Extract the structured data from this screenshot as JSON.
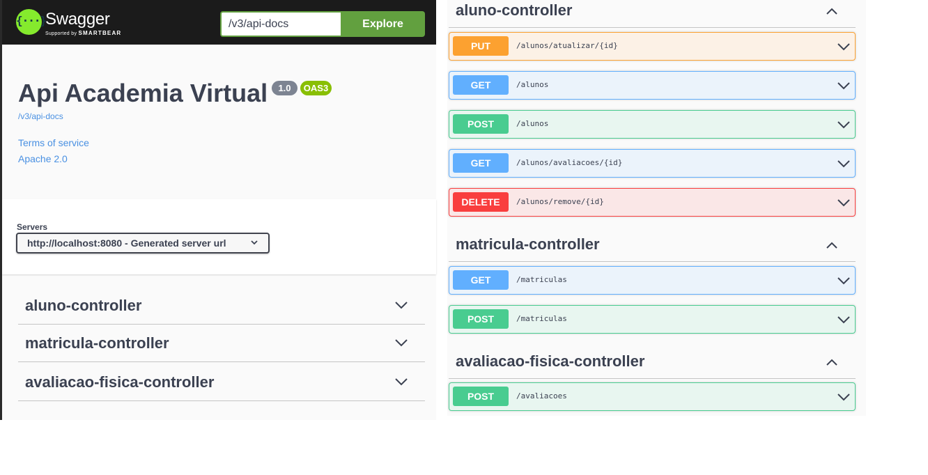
{
  "header": {
    "brand": "Swagger",
    "brand_sub_prefix": "Supported by",
    "brand_sub_company": "SMARTBEAR",
    "logo_glyph": "{···}",
    "url_value": "/v3/api-docs",
    "explore_label": "Explore"
  },
  "info": {
    "title": "Api Academia Virtual",
    "version": "1.0",
    "oas_badge": "OAS3",
    "spec_url": "/v3/api-docs",
    "terms_label": "Terms of service",
    "license_label": "Apache 2.0"
  },
  "servers": {
    "label": "Servers",
    "selected": "http://localhost:8080 - Generated server url"
  },
  "collapsed_tags": [
    "aluno-controller",
    "matricula-controller",
    "avaliacao-fisica-controller"
  ],
  "expanded": {
    "aluno": {
      "name": "aluno-controller",
      "ops": [
        {
          "method": "PUT",
          "path": "/alunos/atualizar/{id}"
        },
        {
          "method": "GET",
          "path": "/alunos"
        },
        {
          "method": "POST",
          "path": "/alunos"
        },
        {
          "method": "GET",
          "path": "/alunos/avaliacoes/{id}"
        },
        {
          "method": "DELETE",
          "path": "/alunos/remove/{id}"
        }
      ]
    },
    "matricula": {
      "name": "matricula-controller",
      "ops": [
        {
          "method": "GET",
          "path": "/matriculas"
        },
        {
          "method": "POST",
          "path": "/matriculas"
        }
      ]
    },
    "avaliacao": {
      "name": "avaliacao-fisica-controller",
      "ops": [
        {
          "method": "POST",
          "path": "/avaliacoes"
        }
      ]
    }
  },
  "colors": {
    "put": "#fca130",
    "get": "#61affe",
    "post": "#49cc90",
    "delete": "#f93e3e",
    "topbar": "#1b1b1b",
    "explore": "#62a03f",
    "link": "#4990e2"
  },
  "icons": {
    "chevron_down": "chevron-down-icon",
    "chevron_up": "chevron-up-icon"
  }
}
